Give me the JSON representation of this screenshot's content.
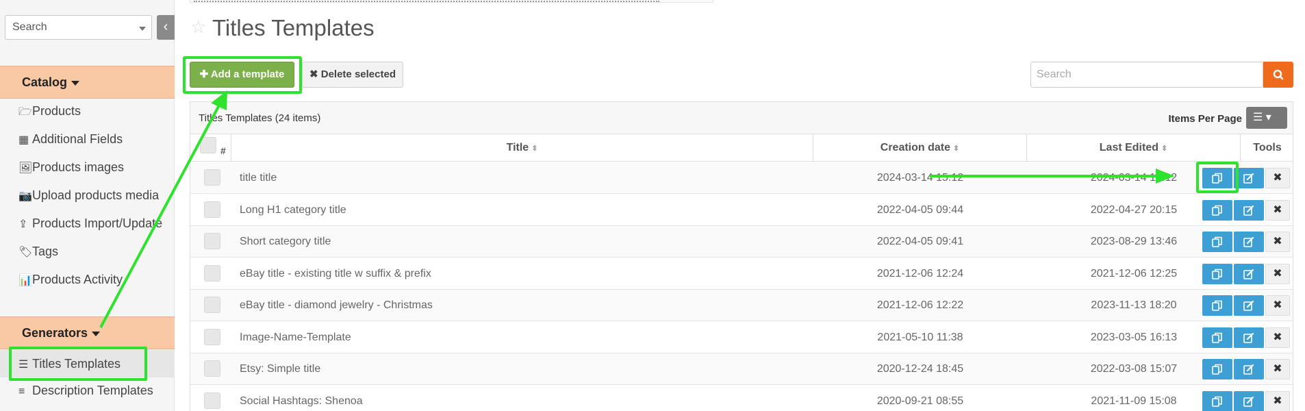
{
  "sidebar": {
    "search_label": "Search",
    "collapse_glyph": "‹",
    "sections": [
      {
        "title": "Catalog"
      },
      {
        "title": "Generators"
      }
    ],
    "catalog_items": [
      {
        "icon": "folder-open-icon",
        "glyph": "🗁",
        "label": "Products"
      },
      {
        "icon": "grid-icon",
        "glyph": "▦",
        "label": "Additional Fields"
      },
      {
        "icon": "image-icon",
        "glyph": "🖼",
        "label": "Products images"
      },
      {
        "icon": "camera-icon",
        "glyph": "📷",
        "label": "Upload products media"
      },
      {
        "icon": "upload-icon",
        "glyph": "⇪",
        "label": "Products Import/Update"
      },
      {
        "icon": "tags-icon",
        "glyph": "🏷",
        "label": "Tags"
      },
      {
        "icon": "bar-chart-icon",
        "glyph": "📊",
        "label": "Products Activity"
      }
    ],
    "generator_items": [
      {
        "icon": "align-center-icon",
        "glyph": "☰",
        "label": "Titles Templates"
      },
      {
        "icon": "align-justify-icon",
        "glyph": "≡",
        "label": "Description Templates"
      }
    ]
  },
  "page": {
    "title": "Titles Templates",
    "star_glyph": "☆"
  },
  "toolbar": {
    "add_label": "Add a template",
    "add_glyph": "✚",
    "delete_label": "Delete selected",
    "delete_glyph": "✖",
    "search_placeholder": "Search"
  },
  "panel": {
    "title": "Titles Templates (24 items)",
    "ipp_label": "Items Per Page",
    "ipp_glyph": "☰ ▾"
  },
  "table": {
    "headers": {
      "index": "#",
      "title": "Title",
      "created": "Creation date",
      "edited": "Last Edited",
      "tools": "Tools"
    },
    "sort_glyph": "⬍",
    "rows": [
      {
        "title": "title title",
        "created": "2024-03-14 15:12",
        "edited": "2024-03-14 15:12"
      },
      {
        "title": "Long H1 category title",
        "created": "2022-04-05 09:44",
        "edited": "2022-04-27 20:15"
      },
      {
        "title": "Short category title",
        "created": "2022-04-05 09:41",
        "edited": "2023-08-29 13:46"
      },
      {
        "title": "eBay title - existing title w suffix & prefix",
        "created": "2021-12-06 12:24",
        "edited": "2021-12-06 12:25"
      },
      {
        "title": "eBay title - diamond jewelry - Christmas",
        "created": "2021-12-06 12:22",
        "edited": "2023-11-13 18:20"
      },
      {
        "title": "Image-Name-Template",
        "created": "2021-05-10 11:38",
        "edited": "2023-03-05 16:13"
      },
      {
        "title": "Etsy: Simple title",
        "created": "2020-12-24 18:45",
        "edited": "2022-03-08 15:07"
      },
      {
        "title": "Social Hashtags: Shenoa",
        "created": "2020-09-21 08:55",
        "edited": "2021-11-09 15:08"
      }
    ],
    "delete_glyph": "✖"
  },
  "colors": {
    "accent_green": "#7bb04a",
    "highlight": "#2ee22e",
    "section_bg": "#f9c8a5",
    "tool_blue": "#3d9fd3",
    "search_orange": "#ee6b1d"
  }
}
